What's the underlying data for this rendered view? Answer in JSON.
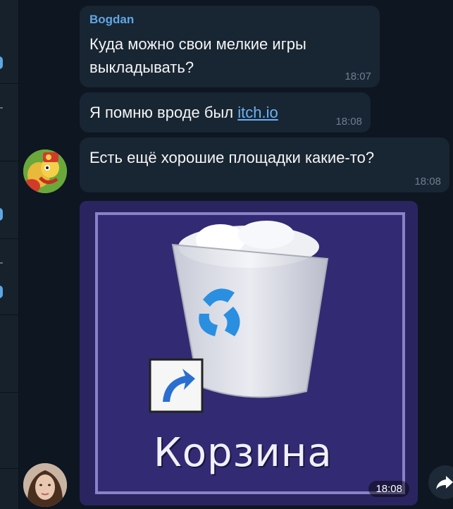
{
  "messages": [
    {
      "sender": "Bogdan",
      "text_line1": "Куда можно свои мелкие игры",
      "text_line2": "выкладывать?",
      "time": "18:07"
    },
    {
      "text": "Я помню вроде был ",
      "link": "itch.io",
      "time": "18:08"
    },
    {
      "text": "Есть ещё хорошие площадки какие-то?",
      "time": "18:08"
    }
  ],
  "image_message": {
    "caption": "Корзина",
    "time": "18:08"
  },
  "colors": {
    "background": "#0e1621",
    "bubble": "#182533",
    "sender": "#5fa7e3",
    "link": "#6ab2f2"
  },
  "icons": [
    "recycle-bin-icon",
    "shortcut-arrow-icon",
    "forward-icon"
  ]
}
